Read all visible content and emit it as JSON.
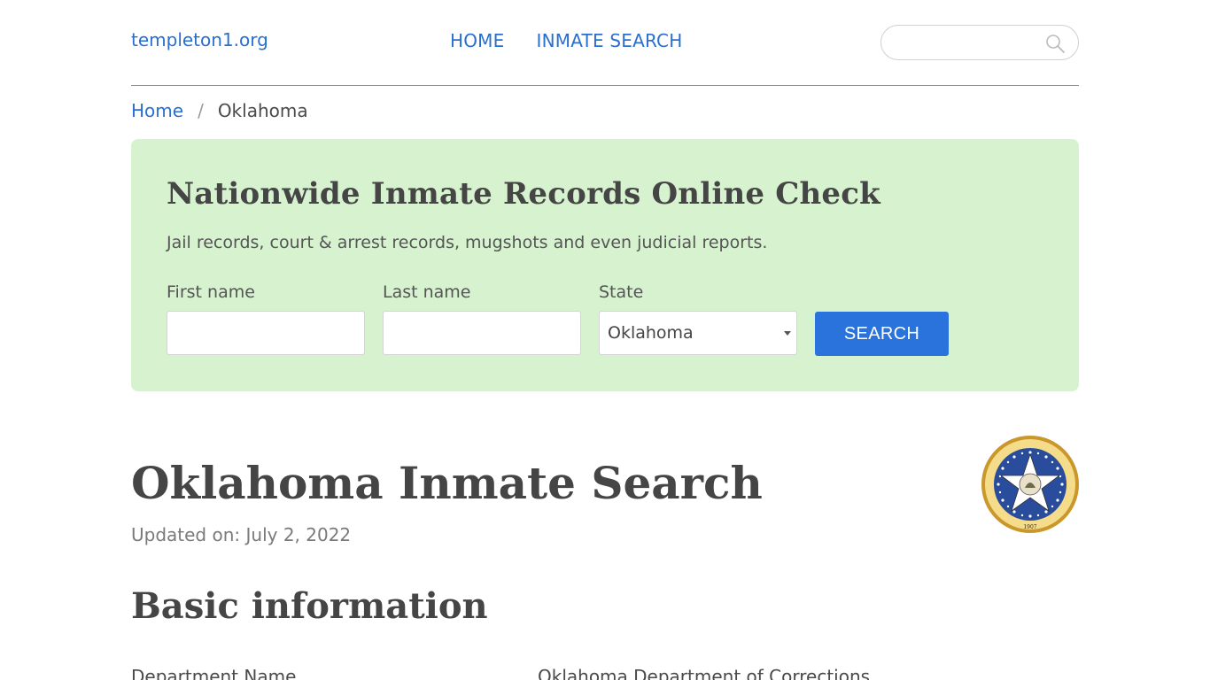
{
  "header": {
    "logo": "templeton1.org",
    "nav": [
      "HOME",
      "INMATE SEARCH"
    ],
    "search_placeholder": ""
  },
  "breadcrumb": {
    "home": "Home",
    "separator": "/",
    "current": "Oklahoma"
  },
  "search_panel": {
    "title": "Nationwide Inmate Records Online Check",
    "subtitle": "Jail records, court & arrest records, mugshots and even judicial reports.",
    "first_name_label": "First name",
    "first_name_value": "",
    "last_name_label": "Last name",
    "last_name_value": "",
    "state_label": "State",
    "state_value": "Oklahoma",
    "button_label": "SEARCH",
    "background_color": "#d6f2cf",
    "button_color": "#2a73dc"
  },
  "main": {
    "title": "Oklahoma Inmate Search",
    "updated": "Updated on: July 2, 2022",
    "seal_text": "GREAT SEAL OF THE STATE OF OKLAHOMA",
    "seal_year": "1907",
    "section_title": "Basic information",
    "info_rows": [
      {
        "label": "Department Name",
        "value": "Oklahoma Department of Corrections"
      }
    ]
  },
  "colors": {
    "link": "#2a6fcf",
    "text": "#4a4a4a"
  }
}
